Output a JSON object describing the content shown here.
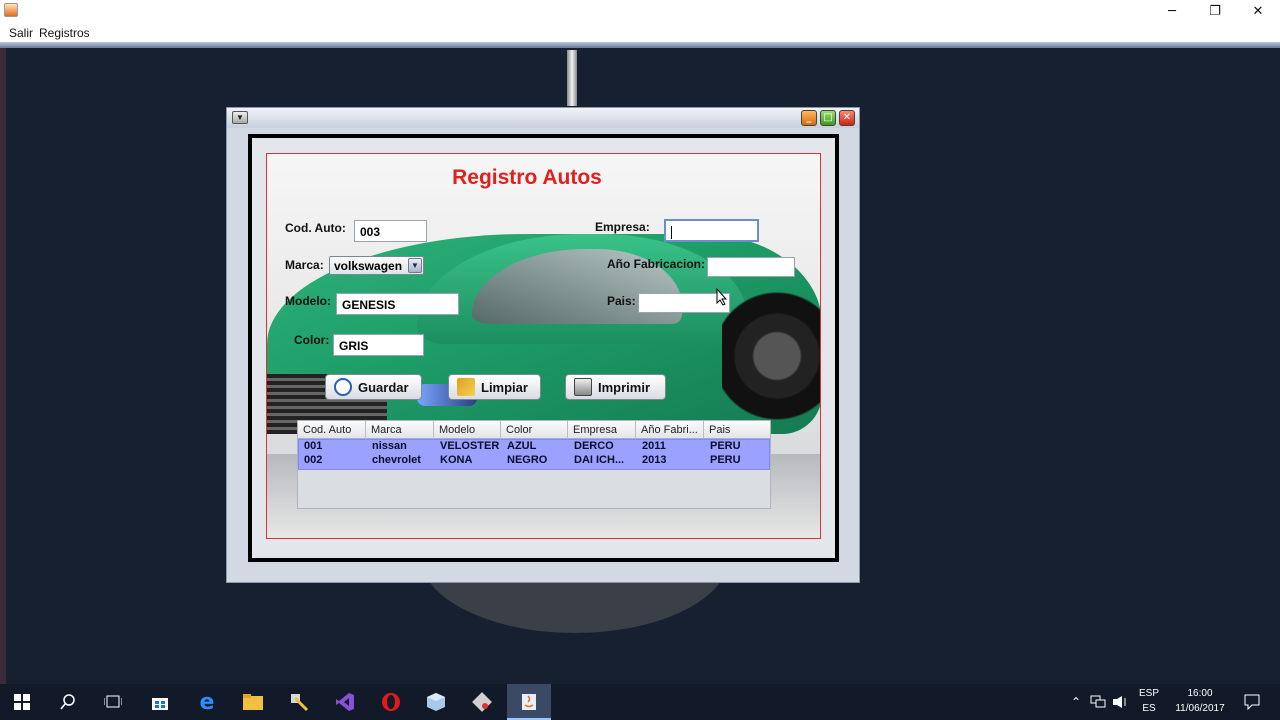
{
  "window": {
    "controls": {
      "minimize": "─",
      "restore": "❐",
      "close": "✕"
    }
  },
  "menubar": {
    "items": [
      "Salir",
      "Registros"
    ]
  },
  "internal_frame": {
    "controls": {
      "minimize": "_",
      "maximize": "□",
      "close": "✕"
    }
  },
  "form": {
    "title": "Registro Autos",
    "fields": {
      "cod_auto": {
        "label": "Cod. Auto:",
        "value": "003"
      },
      "marca": {
        "label": "Marca:",
        "value": "volkswagen"
      },
      "modelo": {
        "label": "Modelo:",
        "value": "GENESIS"
      },
      "color": {
        "label": "Color:",
        "value": "GRIS"
      },
      "empresa": {
        "label": "Empresa:",
        "value": ""
      },
      "anio_fabricacion": {
        "label": "Año Fabricacion:",
        "value": ""
      },
      "pais": {
        "label": "Pais:",
        "value": ""
      }
    },
    "buttons": {
      "guardar": "Guardar",
      "limpiar": "Limpiar",
      "imprimir": "Imprimir"
    }
  },
  "table": {
    "columns": [
      "Cod. Auto",
      "Marca",
      "Modelo",
      "Color",
      "Empresa",
      "Año Fabri...",
      "Pais"
    ],
    "rows": [
      [
        "001",
        "nissan",
        "VELOSTER",
        "AZUL",
        "DERCO",
        "2011",
        "PERU"
      ],
      [
        "002",
        "chevrolet",
        "KONA",
        "NEGRO",
        "DAI ICH...",
        "2013",
        "PERU"
      ]
    ]
  },
  "taskbar": {
    "tray": {
      "lang_top": "ESP",
      "lang_bottom": "ES",
      "time": "16:00",
      "date": "11/06/2017"
    }
  },
  "colors": {
    "accent_red": "#e0201e",
    "selection": "#9aa1ff",
    "car_green": "#1d9c67"
  }
}
